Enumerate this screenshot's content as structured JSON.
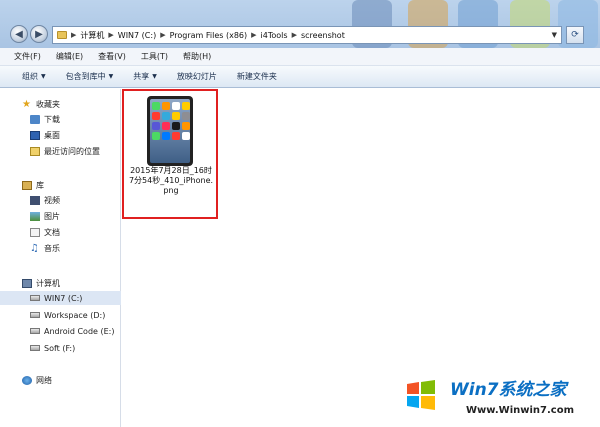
{
  "address_bar": {
    "crumbs": [
      "计算机",
      "WIN7 (C:)",
      "Program Files (x86)",
      "i4Tools",
      "screenshot"
    ]
  },
  "menu": [
    "文件(F)",
    "编辑(E)",
    "查看(V)",
    "工具(T)",
    "帮助(H)"
  ],
  "toolbar": {
    "organize": "组织",
    "include_library": "包含到库中",
    "share": "共享",
    "slideshow": "放映幻灯片",
    "new_folder": "新建文件夹"
  },
  "nav": {
    "favorites": {
      "title": "收藏夹",
      "items": [
        "下载",
        "桌面",
        "最近访问的位置"
      ]
    },
    "libraries": {
      "title": "库",
      "items": [
        "视频",
        "图片",
        "文档",
        "音乐"
      ]
    },
    "computer": {
      "title": "计算机",
      "drives": [
        "WIN7 (C:)",
        "Workspace (D:)",
        "Android Code (E:)",
        "Soft (F:)"
      ]
    },
    "network": "网络"
  },
  "file": {
    "name": "2015年7月28日_16时7分54秒_410_iPhone.png"
  },
  "watermark": {
    "brand": "Win7系统之家",
    "url": "Www.Winwin7.com"
  },
  "colors": {
    "highlight_border": "#e02020",
    "selected_row": "#dce6f4"
  }
}
